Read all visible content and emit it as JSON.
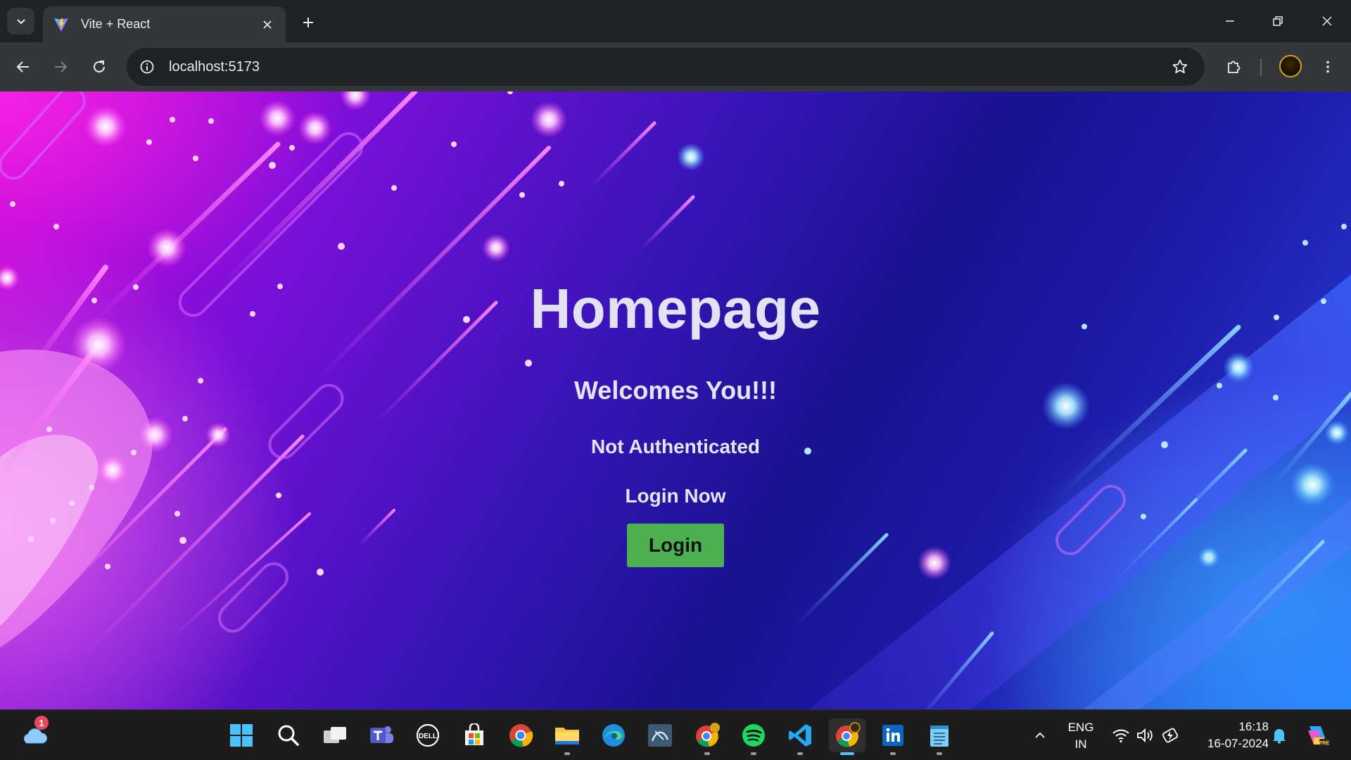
{
  "browser": {
    "tab_title": "Vite + React",
    "url": "localhost:5173"
  },
  "page": {
    "title": "Homepage",
    "welcome": "Welcomes You!!!",
    "auth_status": "Not Authenticated",
    "prompt": "Login Now",
    "login_button": "Login"
  },
  "taskbar": {
    "weather_badge": "1",
    "apps": [
      "start-icon",
      "search-icon",
      "task-view-icon",
      "teams-icon",
      "dell-icon",
      "store-icon",
      "chrome-icon",
      "file-explorer-icon",
      "edge-icon",
      "mysql-workbench-icon",
      "chrome-profile-icon",
      "spotify-icon",
      "vscode-icon",
      "chrome-active-icon",
      "linkedin-icon",
      "notepad-icon"
    ],
    "language_line1": "ENG",
    "language_line2": "IN",
    "time": "16:18",
    "date": "16-07-2024"
  },
  "colors": {
    "login_button": "#4caf50",
    "chrome_dark": "#202124",
    "toolbar": "#35363a",
    "taskbar": "#1c1c1c"
  }
}
